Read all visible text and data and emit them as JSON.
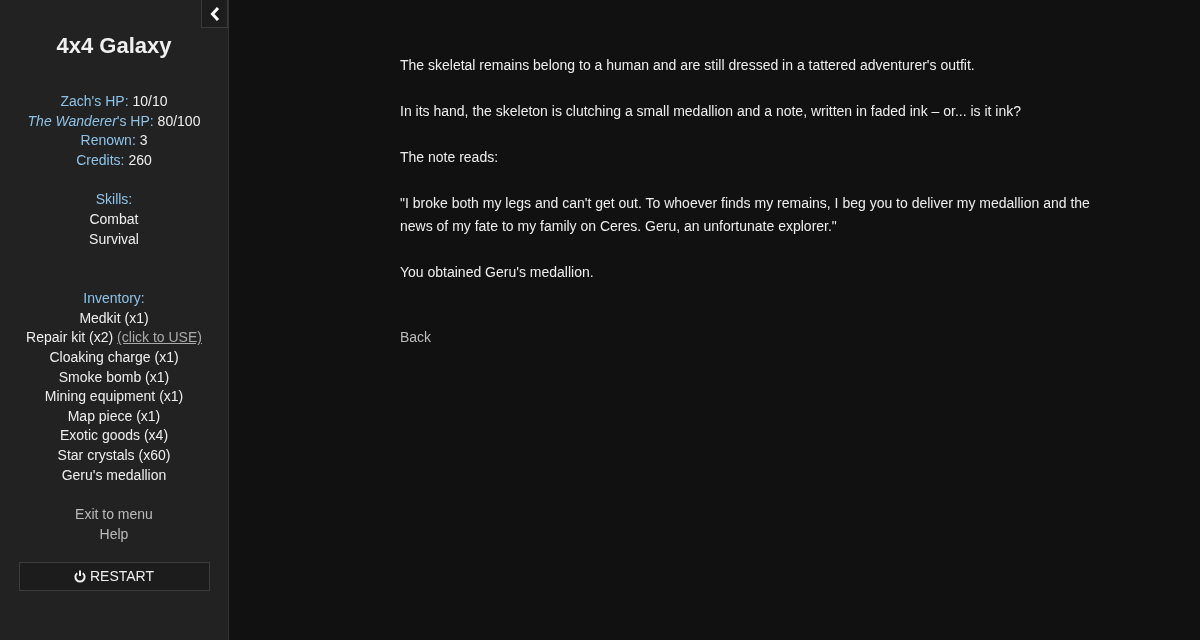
{
  "sidebar": {
    "title": "4x4 Galaxy",
    "stats": [
      {
        "label": "Zach's HP:",
        "value": "10/10"
      },
      {
        "label": "*The Wanderer*'s HP:",
        "value": "80/100"
      },
      {
        "label": "Renown:",
        "value": "3"
      },
      {
        "label": "Credits:",
        "value": "260"
      }
    ],
    "skills": {
      "heading": "Skills:",
      "items": [
        "Combat",
        "Survival"
      ]
    },
    "inventory": {
      "heading": "Inventory:",
      "items": [
        {
          "name": "Medkit (x1)"
        },
        {
          "name": "Repair kit (x2)",
          "action": "(click to USE)"
        },
        {
          "name": "Cloaking charge (x1)"
        },
        {
          "name": "Smoke bomb (x1)"
        },
        {
          "name": "Mining equipment (x1)"
        },
        {
          "name": "Map piece (x1)"
        },
        {
          "name": "Exotic goods (x4)"
        },
        {
          "name": "Star crystals (x60)"
        },
        {
          "name": "Geru's medallion"
        }
      ]
    },
    "links": [
      "Exit to menu",
      "Help"
    ],
    "restart_button": "RESTART"
  },
  "passage": {
    "paragraphs": [
      "The skeletal remains belong to a human and are still dressed in a tattered adventurer's outfit.",
      "In its hand, the skeleton is clutching a small medallion and a note, written in faded ink – or... is it ink?",
      "The note reads:",
      "\"I broke both my legs and can't get out. To whoever finds my remains, I beg you to deliver my medallion and the news of my fate to my family on Ceres. Geru, an unfortunate explorer.\"",
      "You obtained Geru's medallion."
    ],
    "choices": [
      "Back"
    ]
  }
}
